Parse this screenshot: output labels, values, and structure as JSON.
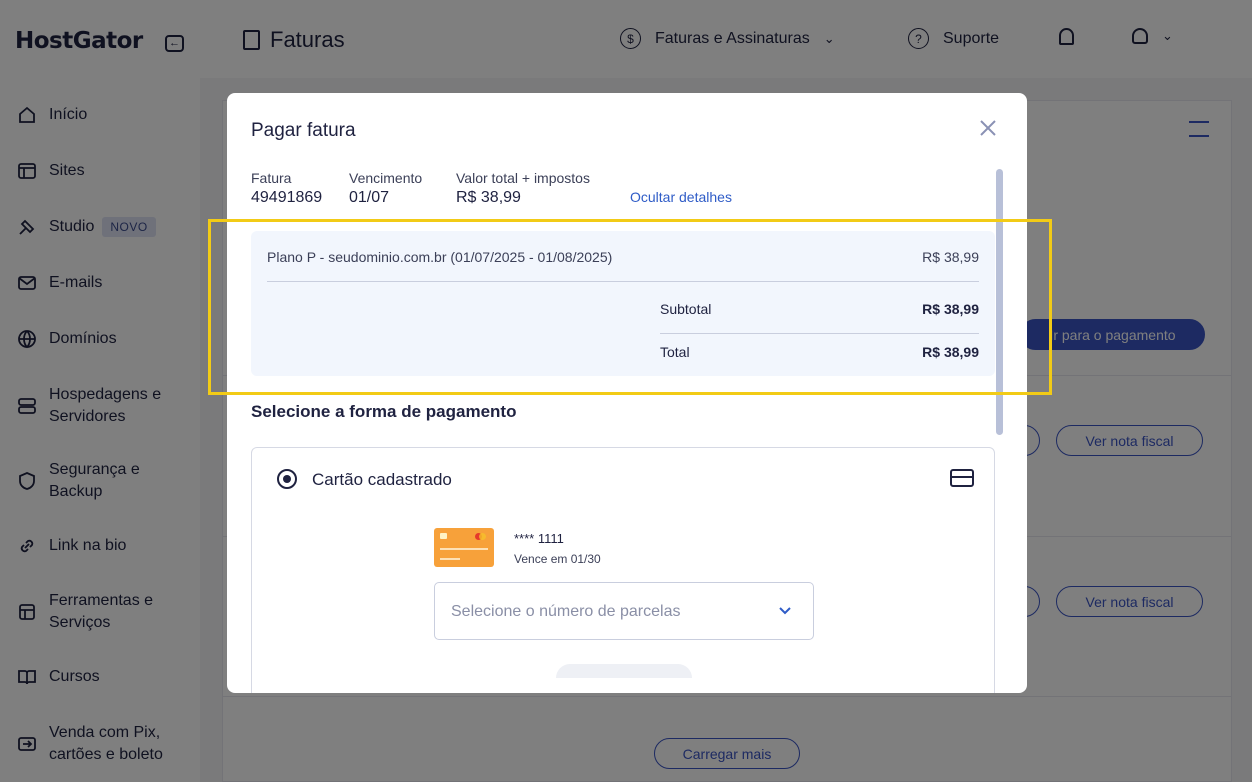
{
  "brand": {
    "name": "HostGator"
  },
  "sidebar": {
    "items": [
      {
        "label": "Início",
        "icon": "home-icon"
      },
      {
        "label": "Sites",
        "icon": "layout-icon"
      },
      {
        "label": "Studio",
        "icon": "studio-icon",
        "badge": "NOVO"
      },
      {
        "label": "E-mails",
        "icon": "mail-icon"
      },
      {
        "label": "Domínios",
        "icon": "globe-icon"
      },
      {
        "label_line1": "Hospedagens e",
        "label_line2": "Servidores",
        "icon": "server-icon"
      },
      {
        "label_line1": "Segurança e",
        "label_line2": "Backup",
        "icon": "shield-icon"
      },
      {
        "label": "Link na bio",
        "icon": "link-icon"
      },
      {
        "label_line1": "Ferramentas e",
        "label_line2": "Serviços",
        "icon": "tools-icon"
      },
      {
        "label": "Cursos",
        "icon": "book-icon"
      },
      {
        "label_line1": "Venda com Pix,",
        "label_line2": "cartões e boleto",
        "icon": "pix-icon"
      }
    ]
  },
  "topbar": {
    "page_title": "Faturas",
    "billing_menu": "Faturas e Assinaturas",
    "support": "Suporte"
  },
  "background": {
    "pay_button": "Ir para o pagamento",
    "invoice_button": "Ver nota fiscal",
    "load_more": "Carregar mais"
  },
  "modal": {
    "title": "Pagar fatura",
    "invoice_label": "Fatura",
    "invoice_value": "49491869",
    "due_label": "Vencimento",
    "due_value": "01/07",
    "total_label": "Valor total + impostos",
    "total_value": "R$ 38,99",
    "toggle_details": "Ocultar detalhes",
    "details": {
      "item_description": "Plano P - seudominio.com.br (01/07/2025 - 01/08/2025)",
      "item_amount": "R$ 38,99",
      "subtotal_label": "Subtotal",
      "subtotal_amount": "R$ 38,99",
      "total_label": "Total",
      "total_amount": "R$ 38,99"
    },
    "payment_heading": "Selecione a forma de pagamento",
    "payment_option": "Cartão cadastrado",
    "card": {
      "number": "**** 1111",
      "expiry": "Vence em 01/30",
      "brand_colors": {
        "card": "#f7a13a",
        "red": "#e63a2b",
        "yellow": "#f5c02a"
      }
    },
    "installments_placeholder": "Selecione o número de parcelas"
  },
  "colors": {
    "accent": "#2f5cc7",
    "highlight": "#f2cb16",
    "details_bg": "#f2f6fd"
  }
}
